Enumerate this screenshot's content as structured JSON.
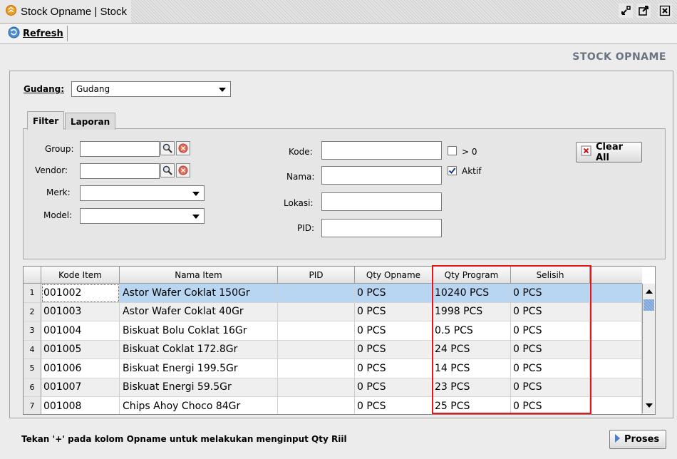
{
  "window": {
    "title": "Stock Opname | Stock"
  },
  "toolbar": {
    "refresh_label": "Refresh"
  },
  "page": {
    "heading": "STOCK OPNAME"
  },
  "gudang": {
    "label": "Gudang:",
    "value": "Gudang"
  },
  "tabs": [
    {
      "label": "Filter"
    },
    {
      "label": "Laporan"
    }
  ],
  "filter": {
    "group_label": "Group:",
    "vendor_label": "Vendor:",
    "merk_label": "Merk:",
    "model_label": "Model:",
    "kode_label": "Kode:",
    "nama_label": "Nama:",
    "lokasi_label": "Lokasi:",
    "pid_label": "PID:",
    "gt_zero_label": "> 0",
    "gt_zero_checked": false,
    "aktif_label": "Aktif",
    "aktif_checked": true,
    "clear_all_label": "Clear All"
  },
  "grid": {
    "columns": [
      "Kode Item",
      "Nama Item",
      "PID",
      "Qty Opname",
      "Qty Program",
      "Selisih"
    ],
    "rows": [
      {
        "no": "1",
        "kode": "001002",
        "nama": "Astor Wafer Coklat 150Gr",
        "pid": "",
        "qty_opname": "0 PCS",
        "qty_program": "10240 PCS",
        "selisih": "0 PCS"
      },
      {
        "no": "2",
        "kode": "001003",
        "nama": "Astor Wafer Coklat 40Gr",
        "pid": "",
        "qty_opname": "0 PCS",
        "qty_program": "1998 PCS",
        "selisih": "0 PCS"
      },
      {
        "no": "3",
        "kode": "001004",
        "nama": "Biskuat Bolu Coklat 16Gr",
        "pid": "",
        "qty_opname": "0 PCS",
        "qty_program": "0.5 PCS",
        "selisih": "0 PCS"
      },
      {
        "no": "4",
        "kode": "001005",
        "nama": "Biskuat Coklat 172.8Gr",
        "pid": "",
        "qty_opname": "0 PCS",
        "qty_program": "24 PCS",
        "selisih": "0 PCS"
      },
      {
        "no": "5",
        "kode": "001006",
        "nama": "Biskuat Energi 199.5Gr",
        "pid": "",
        "qty_opname": "0 PCS",
        "qty_program": "14 PCS",
        "selisih": "0 PCS"
      },
      {
        "no": "6",
        "kode": "001007",
        "nama": "Biskuat Energi 59.5Gr",
        "pid": "",
        "qty_opname": "0 PCS",
        "qty_program": "23 PCS",
        "selisih": "0 PCS"
      },
      {
        "no": "7",
        "kode": "001008",
        "nama": "Chips Ahoy Choco 84Gr",
        "pid": "",
        "qty_opname": "0 PCS",
        "qty_program": "25 PCS",
        "selisih": "0 PCS"
      }
    ]
  },
  "footer": {
    "hint": "Tekan '+' pada kolom Opname untuk melakukan menginput Qty Riil",
    "proses_label": "Proses"
  },
  "colors": {
    "highlight_box": "#e8141b",
    "selected_row": "#b8d6f2",
    "heading": "#6a7480"
  }
}
